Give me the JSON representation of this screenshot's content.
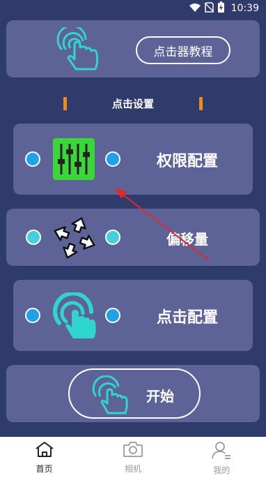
{
  "status_bar": {
    "time": "10:39",
    "icons": [
      "wifi-icon",
      "no-sim-icon",
      "battery-charging-icon"
    ]
  },
  "tutorial": {
    "button_label": "点击器教程",
    "icon": "tap-hand-icon"
  },
  "section": {
    "title": "点击设置"
  },
  "rows": [
    {
      "label": "权限配置",
      "icon": "sliders-icon",
      "dot_color": "#1fa3e8"
    },
    {
      "label": "偏移量",
      "icon": "move-arrows-icon",
      "dot_color": "#46d0dc"
    },
    {
      "label": "点击配置",
      "icon": "tap-hand-icon",
      "dot_color": "#1fa3e8"
    }
  ],
  "start": {
    "label": "开始",
    "icon": "tap-hand-icon"
  },
  "bottom_nav": [
    {
      "label": "首页",
      "icon": "home-icon",
      "active": true
    },
    {
      "label": "相机",
      "icon": "camera-icon",
      "active": false
    },
    {
      "label": "我的",
      "icon": "user-icon",
      "active": false
    }
  ],
  "colors": {
    "background": "#2f3b6b",
    "card": "#5d6396",
    "accent_orange": "#f08a1c",
    "accent_green": "#3ad63a",
    "accent_cyan": "#2fd6d0",
    "arrow_red": "#e8262a"
  }
}
